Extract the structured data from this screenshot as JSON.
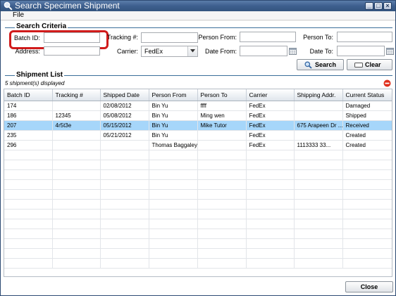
{
  "window": {
    "title": "Search Specimen Shipment",
    "controls": {
      "minimize": "_",
      "maximize": "□",
      "close": "×"
    }
  },
  "menu": {
    "file": "File"
  },
  "search_criteria": {
    "section_title": "Search Criteria",
    "batch_id_label": "Batch ID:",
    "batch_id_value": "",
    "address_label": "Address:",
    "address_value": "",
    "tracking_label": "Tracking #:",
    "tracking_value": "",
    "carrier_label": "Carrier:",
    "carrier_value": "FedEx",
    "person_from_label": "Person From:",
    "person_from_value": "",
    "date_from_label": "Date From:",
    "date_from_value": "",
    "person_to_label": "Person To:",
    "person_to_value": "",
    "date_to_label": "Date To:",
    "date_to_value": "",
    "search_button": "Search",
    "clear_button": "Clear"
  },
  "shipment_list": {
    "section_title": "Shipment List",
    "status": "5 shipment(s) displayed",
    "columns": [
      "Batch ID",
      "Tracking #",
      "Shipped Date",
      "Person From",
      "Person To",
      "Carrier",
      "Shipping Addr.",
      "Current Status"
    ],
    "rows": [
      {
        "batch_id": "174",
        "tracking": "",
        "shipped_date": "02/08/2012",
        "person_from": "Bin Yu",
        "person_to": "ffff",
        "carrier": "FedEx",
        "address": "",
        "status": "Damaged"
      },
      {
        "batch_id": "186",
        "tracking": "12345",
        "shipped_date": "05/08/2012",
        "person_from": "Bin Yu",
        "person_to": "Ming wen",
        "carrier": "FedEx",
        "address": "",
        "status": "Shipped"
      },
      {
        "batch_id": "207",
        "tracking": "4r5t3e",
        "shipped_date": "05/15/2012",
        "person_from": "Bin Yu",
        "person_to": "Mike Tutor",
        "carrier": "FedEx",
        "address": "675 Arapeen Dr ...",
        "status": "Received"
      },
      {
        "batch_id": "235",
        "tracking": "",
        "shipped_date": "05/21/2012",
        "person_from": "Bin Yu",
        "person_to": "",
        "carrier": "FedEx",
        "address": "",
        "status": "Created"
      },
      {
        "batch_id": "296",
        "tracking": "",
        "shipped_date": "",
        "person_from": "Thomas Baggaley",
        "person_to": "",
        "carrier": "FedEx",
        "address": "1113333 33...",
        "status": "Created"
      }
    ],
    "selected_batch_id": "207"
  },
  "footer": {
    "close_button": "Close"
  },
  "colors": {
    "accent": "#3a6e9a",
    "selection": "#a6d6fa",
    "highlight_ring": "#d11b1b",
    "titlebar": "#3e5f8e"
  }
}
